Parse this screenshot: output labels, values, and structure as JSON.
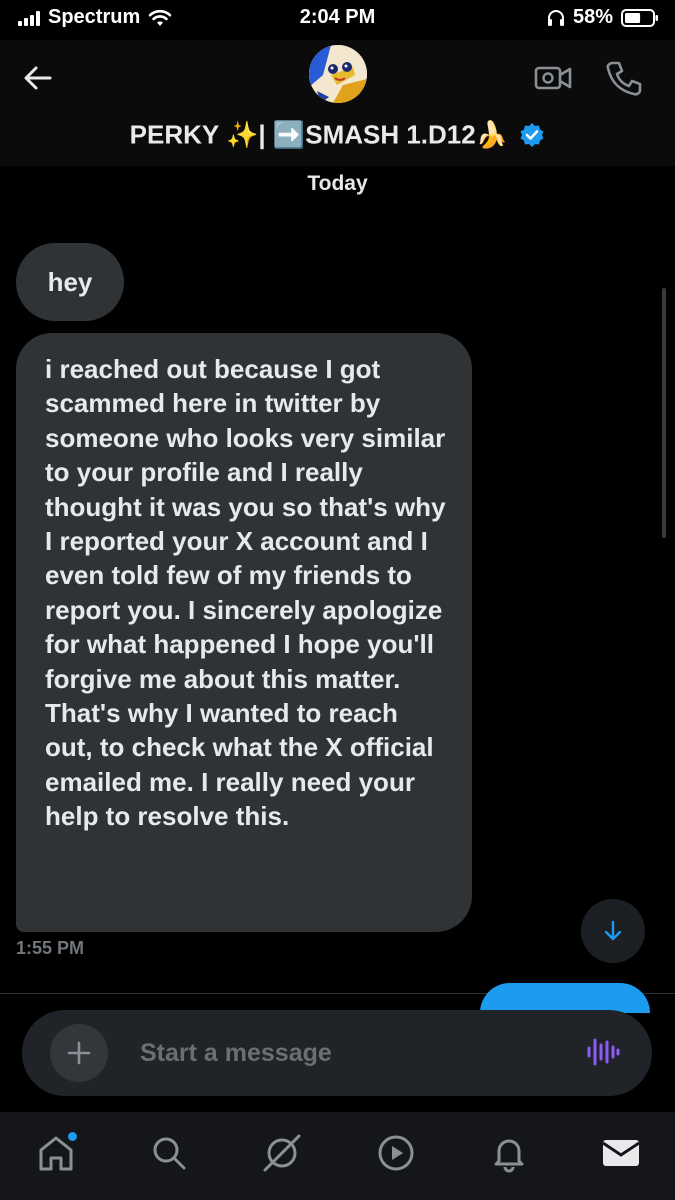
{
  "status_bar": {
    "carrier": "Spectrum",
    "time": "2:04 PM",
    "battery": "58%",
    "battery_level": 0.58
  },
  "header": {
    "back_icon": "arrow-left-icon",
    "video_icon": "video-camera-icon",
    "phone_icon": "phone-icon",
    "title_text": "PERKY ✨| ➡️SMASH 1.D12🍌",
    "verified_icon": "verified-badge-icon"
  },
  "conversation": {
    "date_label": "Today",
    "messages": [
      {
        "text": "hey"
      },
      {
        "text": "i  reached out because I got scammed here in twitter by someone who looks very similar to your profile and I really thought it was you so that's why I reported your X account and I even told few of my friends to report you. I sincerely apologize for what happened I hope you'll forgive me about this matter. That's why I wanted to reach out, to check what the X official emailed me. I really need your help to resolve this."
      }
    ],
    "timestamp": "1:55 PM"
  },
  "composer": {
    "placeholder": "Start a message",
    "add_icon": "plus-icon",
    "voice_icon": "voice-waveform-icon"
  },
  "bottom_nav": {
    "items": [
      "home-icon",
      "search-icon",
      "grok-icon",
      "video-play-icon",
      "bell-icon",
      "mail-icon"
    ]
  },
  "colors": {
    "background": "#000000",
    "bubble": "#2f3336",
    "accent": "#1d9bf0",
    "voice": "#8b5cf6",
    "muted_text": "#71767b"
  }
}
